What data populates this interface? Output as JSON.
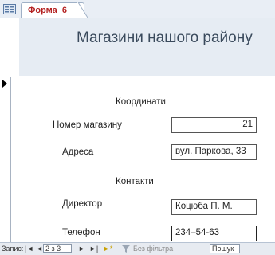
{
  "tab": {
    "label": "Форма_6"
  },
  "header": {
    "title": "Магазини нашого району"
  },
  "sections": {
    "coordinates": "Координати",
    "contacts": "Контакти"
  },
  "fields": {
    "store_number": {
      "label": "Номер магазину",
      "value": "21"
    },
    "address": {
      "label": "Адреса",
      "value": "вул. Паркова, 33"
    },
    "director": {
      "label": "Директор",
      "value": "Коцюба П. М."
    },
    "phone": {
      "label": "Телефон",
      "value": "234–54-63"
    }
  },
  "nav": {
    "record_label": "Запис:",
    "first": "|◄",
    "prev": "◄",
    "record_position": "2 з 3",
    "next": "►",
    "last": "►|",
    "new": "►*",
    "filter_status": "Без фільтра",
    "search_placeholder": "Пошук"
  },
  "colors": {
    "tab_text": "#b32020",
    "header_bg": "#e6ecf3",
    "title": "#3a4a5c"
  }
}
